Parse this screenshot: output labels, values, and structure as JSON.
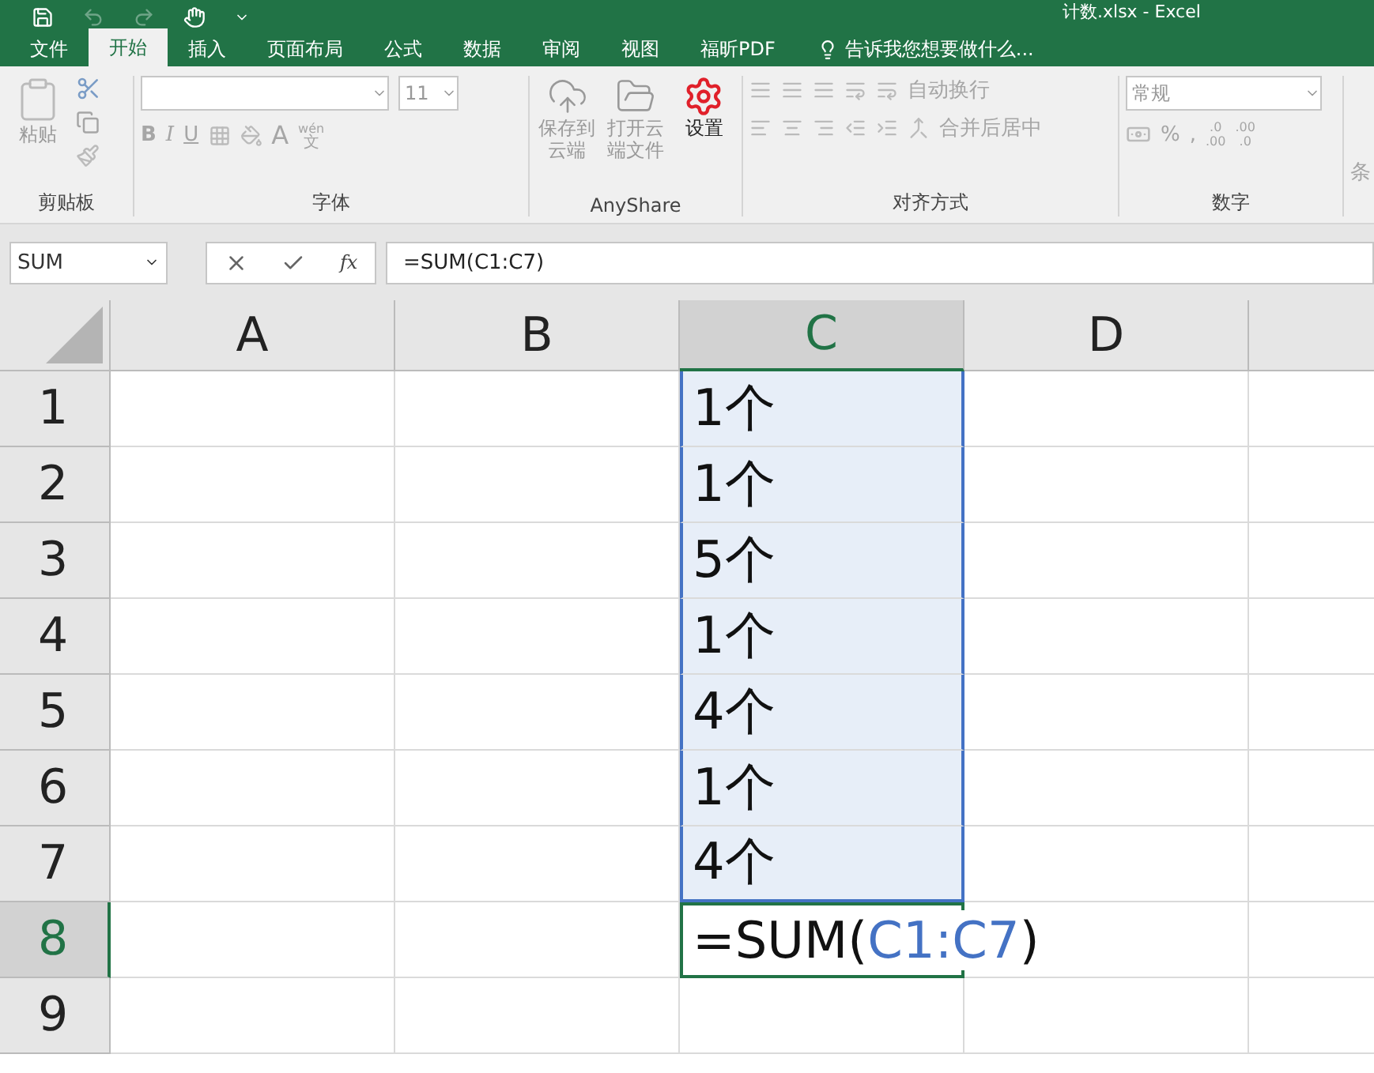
{
  "title": "计数.xlsx - Excel",
  "tabs": [
    {
      "label": "文件",
      "selected": false
    },
    {
      "label": "开始",
      "selected": true
    },
    {
      "label": "插入",
      "selected": false
    },
    {
      "label": "页面布局",
      "selected": false
    },
    {
      "label": "公式",
      "selected": false
    },
    {
      "label": "数据",
      "selected": false
    },
    {
      "label": "审阅",
      "selected": false
    },
    {
      "label": "视图",
      "selected": false
    },
    {
      "label": "福昕PDF",
      "selected": false
    }
  ],
  "tell_me": "告诉我您想要做什么...",
  "ribbon": {
    "clipboard": {
      "label": "剪贴板",
      "paste": "粘贴",
      "disabled": true
    },
    "font": {
      "label": "字体",
      "size": "11",
      "bold": "B",
      "italic": "I",
      "underline": "U",
      "font_color": "A",
      "phonetic_top": "wén",
      "phonetic_bottom": "文",
      "disabled": true
    },
    "anyshare": {
      "label": "AnyShare",
      "buttons": [
        {
          "label": "保存到云端",
          "kind": "save",
          "disabled": true
        },
        {
          "label": "打开云端文件",
          "kind": "open",
          "disabled": true
        },
        {
          "label": "设置",
          "kind": "settings",
          "disabled": false
        }
      ]
    },
    "alignment": {
      "label": "对齐方式",
      "wrap": "自动换行",
      "merge": "合并后居中",
      "disabled": true
    },
    "number": {
      "label": "数字",
      "format": "常规",
      "percent": "%",
      "comma": ",",
      "inc_top": ".0",
      "inc_bottom": ".00",
      "dec_top": ".00",
      "dec_bottom": ".0",
      "disabled": true
    },
    "next_group": "条"
  },
  "formula_bar": {
    "name_box": "SUM",
    "fx": "fx",
    "formula": "=SUM(C1:C7)"
  },
  "sheet": {
    "columns": [
      {
        "label": "A",
        "selected": false
      },
      {
        "label": "B",
        "selected": false
      },
      {
        "label": "C",
        "selected": true
      },
      {
        "label": "D",
        "selected": false
      }
    ],
    "rows": [
      {
        "header": "1",
        "selected": false,
        "in_range": true,
        "value": "1个"
      },
      {
        "header": "2",
        "selected": false,
        "in_range": true,
        "value": "1个"
      },
      {
        "header": "3",
        "selected": false,
        "in_range": true,
        "value": "5个"
      },
      {
        "header": "4",
        "selected": false,
        "in_range": true,
        "value": "1个"
      },
      {
        "header": "5",
        "selected": false,
        "in_range": true,
        "value": "4个"
      },
      {
        "header": "6",
        "selected": false,
        "in_range": true,
        "value": "1个"
      },
      {
        "header": "7",
        "selected": false,
        "in_range": true,
        "value": "4个"
      },
      {
        "header": "8",
        "selected": true,
        "in_range": false,
        "active": true,
        "formula": [
          {
            "text": "=SUM(",
            "kind": "plain"
          },
          {
            "text": "C1:C7",
            "kind": "ref"
          },
          {
            "text": ")",
            "kind": "plain"
          }
        ]
      },
      {
        "header": "9",
        "selected": false,
        "in_range": false
      }
    ]
  }
}
